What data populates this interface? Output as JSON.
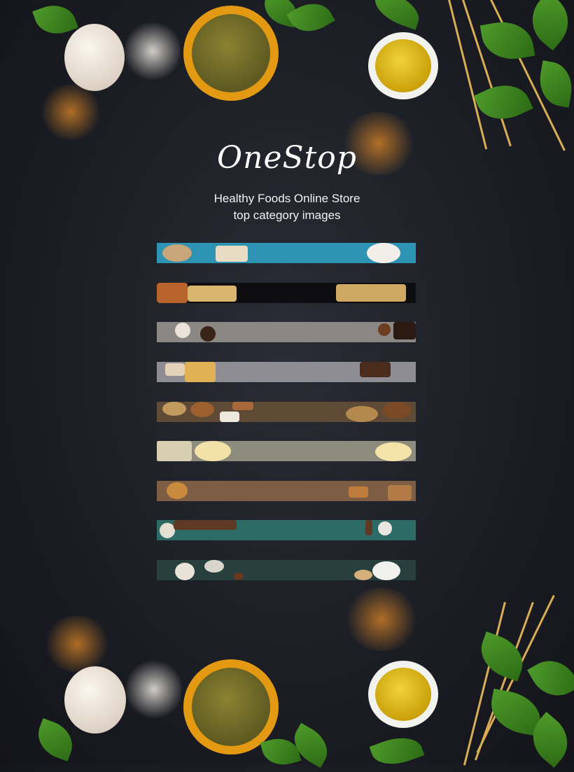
{
  "brand": {
    "name": "OneStop"
  },
  "subtitle": {
    "line1": "Healthy Foods Online Store",
    "line2": "top category images"
  },
  "strips": [
    {
      "color": "#2f93b4"
    },
    {
      "color": "#0e0e10"
    },
    {
      "color": "#8a8784"
    },
    {
      "color": "#8e8d93"
    },
    {
      "color": "#5f4a35"
    },
    {
      "color": "#8d8c7d"
    },
    {
      "color": "#7d5d43"
    },
    {
      "color": "#2d6b66"
    },
    {
      "color": "#27403d"
    }
  ]
}
